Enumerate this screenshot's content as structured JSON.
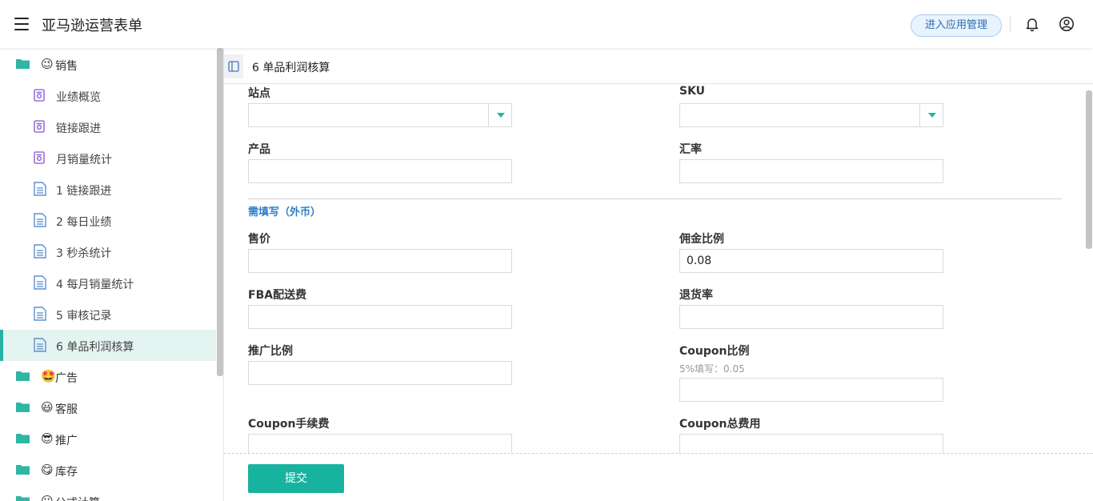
{
  "header": {
    "title": "亚马逊运营表单",
    "admin_button": "进入应用管理"
  },
  "sidebar": {
    "groups_top": [
      {
        "emoji": "😉",
        "label": "销售"
      }
    ],
    "children": [
      {
        "type": "form",
        "label": "业绩概览"
      },
      {
        "type": "form",
        "label": "链接跟进"
      },
      {
        "type": "form",
        "label": "月销量统计"
      },
      {
        "type": "page",
        "label": "1 链接跟进"
      },
      {
        "type": "page",
        "label": "2 每日业绩"
      },
      {
        "type": "page",
        "label": "3 秒杀统计"
      },
      {
        "type": "page",
        "label": "4 每月销量统计"
      },
      {
        "type": "page",
        "label": "5 审核记录"
      },
      {
        "type": "page",
        "label": "6 单品利润核算",
        "active": true
      }
    ],
    "groups_bottom": [
      {
        "emoji": "🤩",
        "label": "广告"
      },
      {
        "emoji": "😃",
        "label": "客服"
      },
      {
        "emoji": "😎",
        "label": "推广"
      },
      {
        "emoji": "😋",
        "label": "库存"
      },
      {
        "emoji": "😐",
        "label": "公式计算"
      }
    ],
    "colors": {
      "folder": "#2fb6a5",
      "form_icon": "#9b6fd6",
      "page_icon": "#5b8fd0",
      "active_bg": "#e4f4f1"
    }
  },
  "page": {
    "tab_title": "6 单品利润核算",
    "fields": {
      "site": {
        "label": "站点",
        "value": ""
      },
      "sku": {
        "label": "SKU",
        "value": ""
      },
      "product": {
        "label": "产品",
        "value": ""
      },
      "exchange_rate": {
        "label": "汇率",
        "value": ""
      },
      "section_title": "需填写（外币）",
      "price": {
        "label": "售价",
        "value": ""
      },
      "commission": {
        "label": "佣金比例",
        "value": "0.08"
      },
      "fba_fee": {
        "label": "FBA配送费",
        "value": ""
      },
      "return_rate": {
        "label": "退货率",
        "value": ""
      },
      "promo_ratio": {
        "label": "推广比例",
        "value": ""
      },
      "coupon_ratio": {
        "label": "Coupon比例",
        "hint": "5%填写：0.05",
        "value": ""
      },
      "coupon_fee": {
        "label": "Coupon手续费",
        "value": ""
      },
      "coupon_total": {
        "label": "Coupon总费用",
        "value": ""
      }
    },
    "submit_label": "提交"
  }
}
